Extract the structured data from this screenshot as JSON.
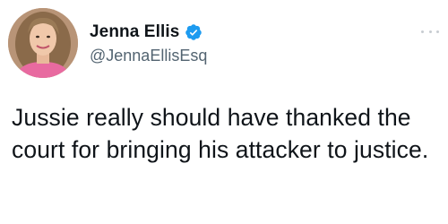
{
  "author": {
    "display_name": "Jenna Ellis",
    "handle": "@JennaEllisEsq",
    "verified": true,
    "avatar_icon": "profile-photo"
  },
  "tweet": {
    "text": "Jussie really should have thanked the court for bringing his attacker to justice."
  },
  "colors": {
    "verified_badge": "#1d9bf0",
    "handle": "#536471",
    "text": "#0f1419"
  }
}
